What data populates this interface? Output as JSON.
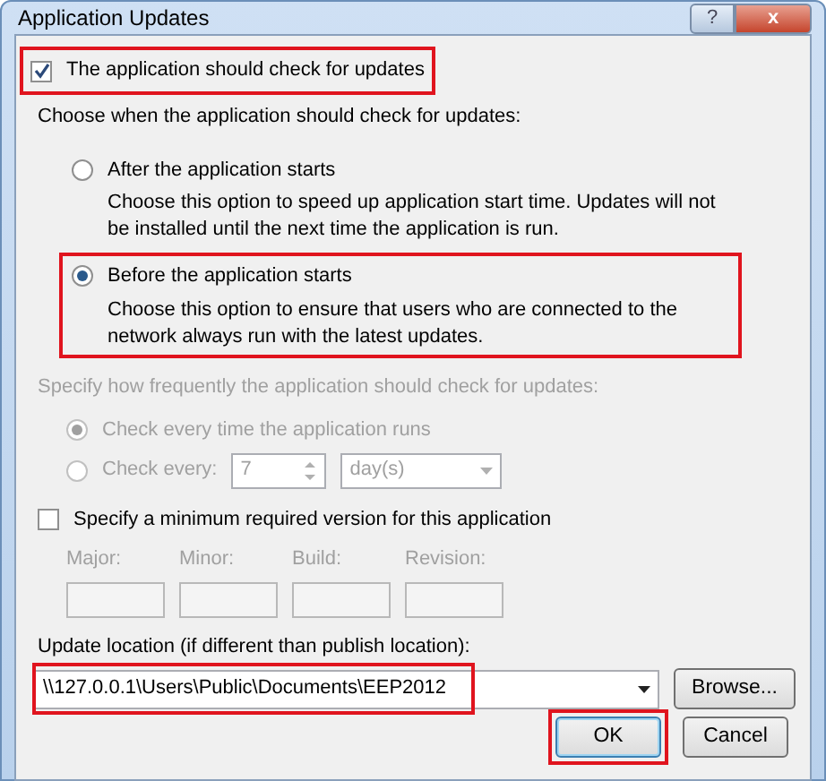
{
  "window": {
    "title": "Application Updates",
    "help_button": "?",
    "close_button": "x"
  },
  "check_updates": {
    "label": "The application should check for updates",
    "checked": true,
    "highlighted": true
  },
  "when_label": "Choose when the application should check for updates:",
  "when_options": [
    {
      "label": "After the application starts",
      "description": "Choose this option to speed up application start time. Updates will not be installed until the next time the application is run.",
      "selected": false,
      "highlighted": false
    },
    {
      "label": "Before the application starts",
      "description": "Choose this option to ensure that users who are connected to the network always run with the latest updates.",
      "selected": true,
      "highlighted": true
    }
  ],
  "frequency": {
    "label": "Specify how frequently the application should check for updates:",
    "disabled": true,
    "options": [
      {
        "kind": "plain",
        "label": "Check every time the application runs",
        "selected": true
      },
      {
        "kind": "interval",
        "label": "Check every:",
        "selected": false,
        "value": "7",
        "unit": "day(s)"
      }
    ]
  },
  "min_version": {
    "label": "Specify a minimum required version for this application",
    "checked": false,
    "disabled": true,
    "fields": [
      "Major:",
      "Minor:",
      "Build:",
      "Revision:"
    ]
  },
  "update_location": {
    "label": "Update location (if different than publish location):",
    "value": "\\\\127.0.0.1\\Users\\Public\\Documents\\EEP2012",
    "highlighted": true
  },
  "browse_button": "Browse...",
  "footer_buttons": [
    {
      "label": "OK",
      "default": true,
      "highlighted": true
    },
    {
      "label": "Cancel",
      "default": false,
      "highlighted": false
    }
  ]
}
